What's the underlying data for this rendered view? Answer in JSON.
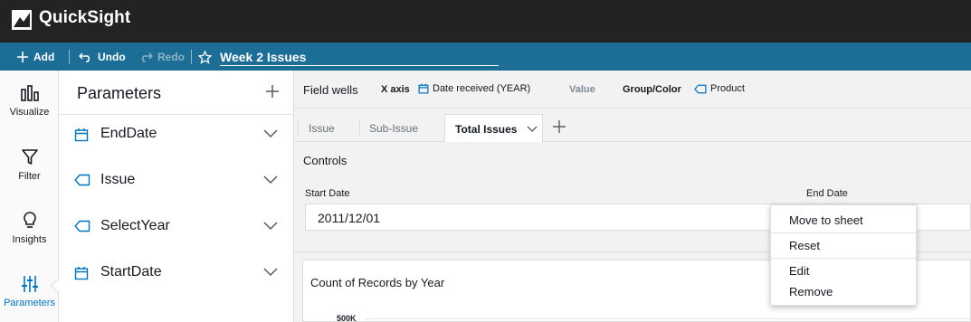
{
  "app": {
    "title": "QuickSight"
  },
  "toolbar": {
    "add_label": "Add",
    "undo_label": "Undo",
    "redo_label": "Redo",
    "analysis_name": "Week 2 Issues"
  },
  "rail": {
    "items": [
      {
        "label": "Visualize",
        "icon": "bar-chart-icon"
      },
      {
        "label": "Filter",
        "icon": "filter-icon"
      },
      {
        "label": "Insights",
        "icon": "lightbulb-icon"
      },
      {
        "label": "Parameters",
        "icon": "sliders-icon",
        "active": true
      }
    ]
  },
  "parameters": {
    "title": "Parameters",
    "items": [
      {
        "label": "EndDate",
        "type_icon": "calendar-icon"
      },
      {
        "label": "Issue",
        "type_icon": "tag-icon"
      },
      {
        "label": "SelectYear",
        "type_icon": "tag-icon"
      },
      {
        "label": "StartDate",
        "type_icon": "calendar-icon"
      }
    ]
  },
  "field_wells": {
    "title": "Field wells",
    "x_axis_label": "X axis",
    "x_axis_value": "Date received (YEAR)",
    "value_label": "Value",
    "group_label": "Group/Color",
    "group_value": "Product"
  },
  "sheets": {
    "tabs": [
      {
        "label": "Issue"
      },
      {
        "label": "Sub-Issue"
      },
      {
        "label": "Total Issues",
        "active": true
      }
    ]
  },
  "controls": {
    "title": "Controls",
    "start_date_label": "Start Date",
    "end_date_label": "End Date",
    "start_date_value": "2011/12/01"
  },
  "visual": {
    "title": "Count of Records by Year",
    "y_tick_top": "500K"
  },
  "context_menu": {
    "items": [
      "Move to sheet",
      "Reset",
      "Edit",
      "Remove"
    ]
  },
  "colors": {
    "topbar": "#232323",
    "toolbar": "#1d6e96",
    "accent": "#0073bb",
    "param_icon": "#0073bb"
  }
}
